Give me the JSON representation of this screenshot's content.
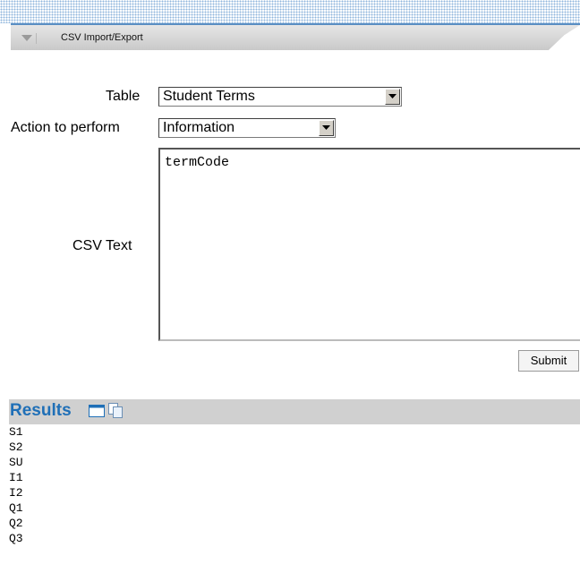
{
  "header": {
    "title": "CSV Import/Export"
  },
  "form": {
    "table_label": "Table",
    "table_value": "Student Terms",
    "action_label": "Action to perform",
    "action_value": "Information",
    "csv_label": "CSV Text",
    "csv_value": "termCode",
    "submit_label": "Submit"
  },
  "results": {
    "title": "Results",
    "icons": [
      "window-icon",
      "copy-icon"
    ],
    "items": [
      "S1",
      "S2",
      "SU",
      "I1",
      "I2",
      "Q1",
      "Q2",
      "Q3"
    ]
  },
  "colors": {
    "accent": "#1f6fb7",
    "header_border": "#5a8ec3",
    "bar_gray": "#d0d0d0"
  }
}
